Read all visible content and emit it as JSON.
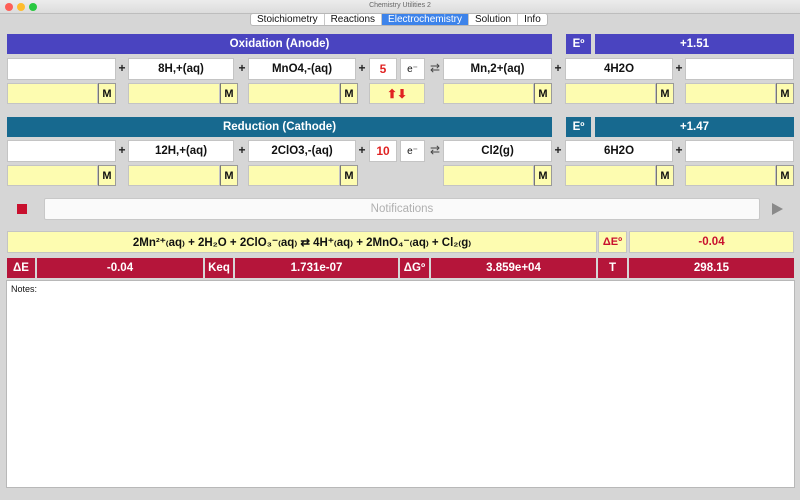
{
  "window": {
    "title": "Chemistry Utilities 2"
  },
  "tabs": [
    {
      "label": "Stoichiometry"
    },
    {
      "label": "Reactions"
    },
    {
      "label": "Electrochemistry"
    },
    {
      "label": "Solution"
    },
    {
      "label": "Info"
    }
  ],
  "oxidation": {
    "header": "Oxidation (Anode)",
    "e_label": "Eº",
    "e_value": "+1.51",
    "species": [
      "",
      "8H,+(aq)",
      "MnO4,-(aq)",
      "Mn,2+(aq)",
      "4H2O",
      ""
    ],
    "electrons": "5",
    "electron_label": "e⁻",
    "arrows": "⬆⬇",
    "molarity_unit": "M"
  },
  "reduction": {
    "header": "Reduction (Cathode)",
    "e_label": "Eº",
    "e_value": "+1.47",
    "species": [
      "",
      "12H,+(aq)",
      "2ClO3,-(aq)",
      "Cl2(g)",
      "6H2O",
      ""
    ],
    "electrons": "10",
    "electron_label": "e⁻",
    "molarity_unit": "M"
  },
  "plus_sign": "+",
  "equilibrium_sign": "⇄",
  "notifications": {
    "placeholder": "Notifications"
  },
  "overall": {
    "equation": "2Mn²⁺₍aq₎ + 2H₂O + 2ClO₃⁻₍aq₎ ⇄ 4H⁺₍aq₎ + 2MnO₄⁻₍aq₎ + Cl₂₍g₎",
    "delta_e0_label": "ΔEº",
    "delta_e0_value": "-0.04"
  },
  "results": {
    "delta_e_label": "ΔE",
    "delta_e_value": "-0.04",
    "keq_label": "Keq",
    "keq_value": "1.731e-07",
    "delta_g_label": "ΔGº",
    "delta_g_value": "3.859e+04",
    "t_label": "T",
    "t_value": "298.15"
  },
  "notes": {
    "label": "Notes:"
  },
  "colors": {
    "oxidation_bar": "#4a44c0",
    "reduction_bar": "#17698f",
    "results_bar": "#b5153a",
    "highlight_yellow": "#fdfcb0",
    "electron_count": "#e02222"
  }
}
